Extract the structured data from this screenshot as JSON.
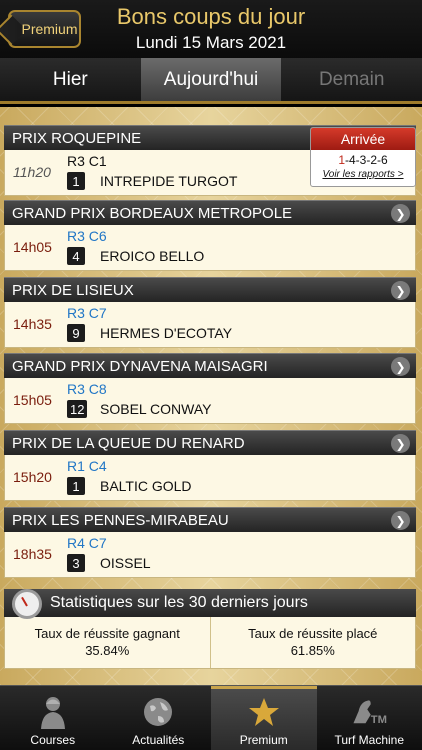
{
  "header": {
    "premium_label": "Premium",
    "title": "Bons coups du jour",
    "date": "Lundi 15 Mars 2021"
  },
  "tabs": [
    {
      "label": "Hier"
    },
    {
      "label": "Aujourd'hui"
    },
    {
      "label": "Demain"
    }
  ],
  "races": [
    {
      "name": "PRIX ROQUEPINE",
      "time": "11h20",
      "rc": "R3 C1",
      "num": "1",
      "horse": "INTREPIDE TURGOT"
    },
    {
      "name": "GRAND PRIX BORDEAUX METROPOLE",
      "time": "14h05",
      "rc": "R3 C6",
      "num": "4",
      "horse": "EROICO BELLO"
    },
    {
      "name": "PRIX DE LISIEUX",
      "time": "14h35",
      "rc": "R3 C7",
      "num": "9",
      "horse": "HERMES D'ECOTAY"
    },
    {
      "name": "GRAND PRIX DYNAVENA MAISAGRI",
      "time": "15h05",
      "rc": "R3 C8",
      "num": "12",
      "horse": "SOBEL CONWAY"
    },
    {
      "name": "PRIX DE LA QUEUE DU RENARD",
      "time": "15h20",
      "rc": "R1 C4",
      "num": "1",
      "horse": "BALTIC GOLD"
    },
    {
      "name": "PRIX LES PENNES-MIRABEAU",
      "time": "18h35",
      "rc": "R4 C7",
      "num": "3",
      "horse": "OISSEL"
    }
  ],
  "arrivee": {
    "title": "Arrivée",
    "first": "1",
    "rest": "-4-3-2-6",
    "link": "Voir les rapports >"
  },
  "stats": {
    "title": "Statistiques sur les 30 derniers jours",
    "win_label": "Taux de réussite gagnant",
    "win_value": "35.84%",
    "place_label": "Taux de réussite placé",
    "place_value": "61.85%"
  },
  "bottom_tabs": [
    {
      "label": "Courses",
      "icon": "jockey-icon"
    },
    {
      "label": "Actualités",
      "icon": "globe-icon"
    },
    {
      "label": "Premium",
      "icon": "star-icon"
    },
    {
      "label": "Turf Machine",
      "icon": "tm-horse-icon"
    }
  ],
  "colors": {
    "accent": "#e9c86a",
    "time": "#7a1d0d",
    "rc": "#2277c6",
    "arrivee": "#c0281a"
  }
}
